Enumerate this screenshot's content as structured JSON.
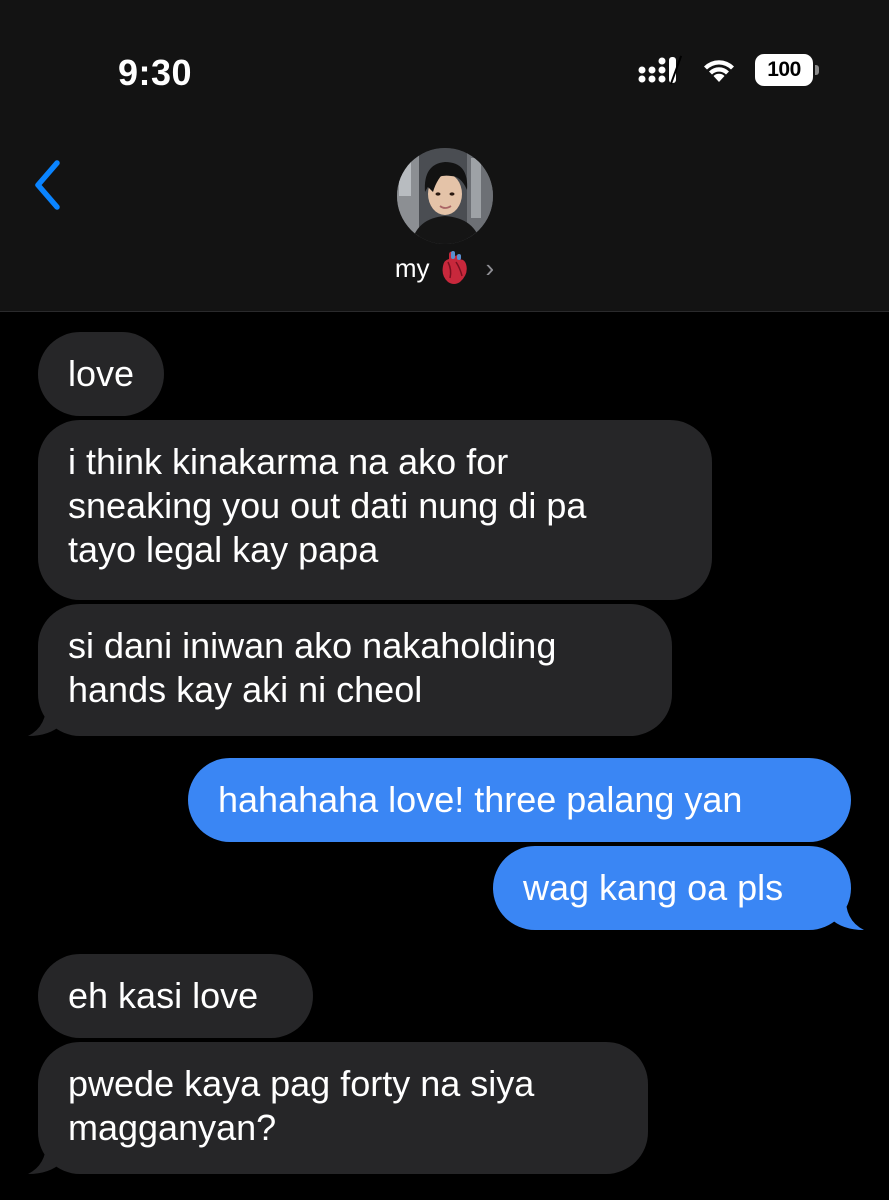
{
  "status_bar": {
    "time": "9:30",
    "battery": "100"
  },
  "header": {
    "contact_name": "my",
    "contact_emoji": "anatomical-heart",
    "back_icon": "chevron-left-icon",
    "detail_icon": "chevron-right-icon"
  },
  "colors": {
    "incoming_bubble": "#262628",
    "outgoing_bubble": "#3a86f4",
    "accent": "#0a84ff"
  },
  "messages": [
    {
      "direction": "incoming",
      "lines": [
        "love"
      ]
    },
    {
      "direction": "incoming",
      "lines": [
        "i think kinakarma na ako for",
        "sneaking you out dati nung di pa",
        "tayo legal kay papa"
      ]
    },
    {
      "direction": "incoming",
      "lines": [
        "si dani iniwan ako nakaholding",
        "hands kay aki ni cheol"
      ]
    },
    {
      "direction": "outgoing",
      "lines": [
        "hahahaha love! three palang yan"
      ]
    },
    {
      "direction": "outgoing",
      "lines": [
        "wag kang oa pls"
      ]
    },
    {
      "direction": "incoming",
      "lines": [
        "eh kasi love"
      ]
    },
    {
      "direction": "incoming",
      "lines": [
        "pwede kaya pag forty na siya",
        "magganyan?"
      ]
    }
  ]
}
